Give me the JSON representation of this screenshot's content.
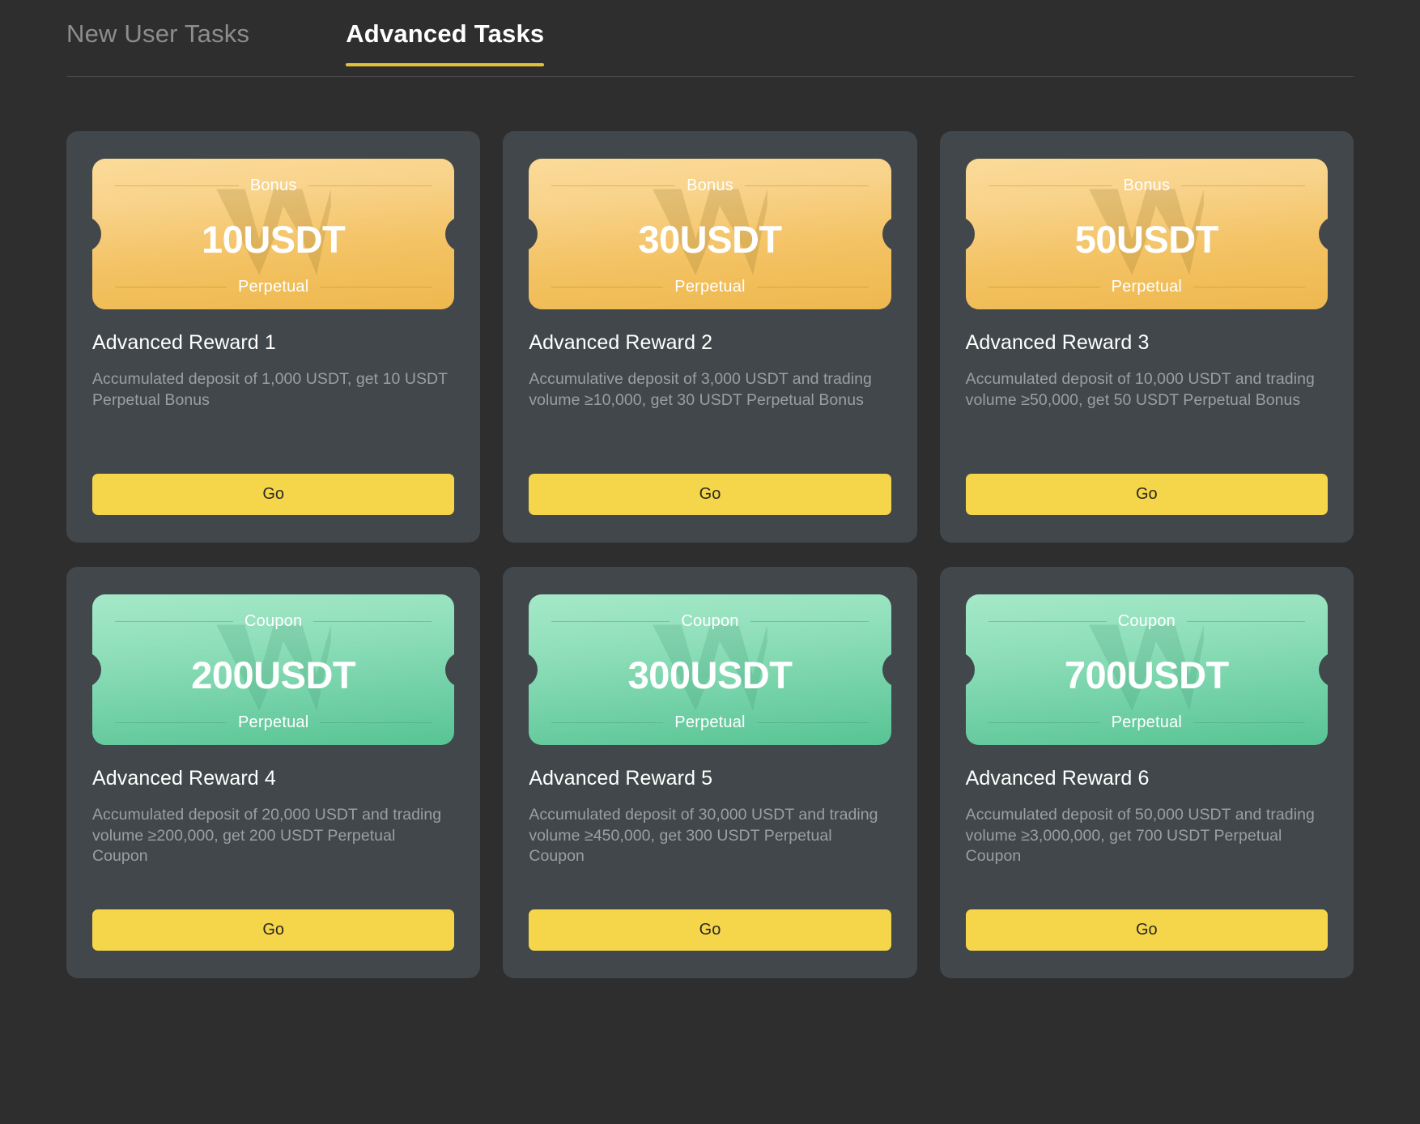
{
  "tabs": [
    {
      "label": "New User Tasks",
      "active": false
    },
    {
      "label": "Advanced Tasks",
      "active": true
    }
  ],
  "colors": {
    "page_background": "#2e2e2e",
    "card_background": "#41474a",
    "tab_active_underline": "#e3c03c",
    "go_button": "#f5d54a",
    "bonus_ticket": "#f3c263",
    "coupon_ticket": "#6fcfa4",
    "title_text": "#ffffff",
    "desc_text": "#9aa0a0"
  },
  "cards": [
    {
      "ticket_type": "Bonus",
      "ticket_style": "bonus",
      "amount": "10USDT",
      "ticket_footer": "Perpetual",
      "title": "Advanced Reward 1",
      "description": "Accumulated deposit of 1,000 USDT, get 10 USDT Perpetual Bonus",
      "button_label": "Go",
      "watermark": "w-logo-icon"
    },
    {
      "ticket_type": "Bonus",
      "ticket_style": "bonus",
      "amount": "30USDT",
      "ticket_footer": "Perpetual",
      "title": "Advanced Reward 2",
      "description": "Accumulative deposit of 3,000 USDT and trading volume ≥10,000, get 30 USDT Perpetual Bonus",
      "button_label": "Go",
      "watermark": "w-logo-icon"
    },
    {
      "ticket_type": "Bonus",
      "ticket_style": "bonus",
      "amount": "50USDT",
      "ticket_footer": "Perpetual",
      "title": "Advanced Reward 3",
      "description": "Accumulated deposit of 10,000 USDT and trading volume ≥50,000, get 50 USDT Perpetual Bonus",
      "button_label": "Go",
      "watermark": "w-logo-icon"
    },
    {
      "ticket_type": "Coupon",
      "ticket_style": "coupon",
      "amount": "200USDT",
      "ticket_footer": "Perpetual",
      "title": "Advanced Reward 4",
      "description": "Accumulated deposit of 20,000 USDT and trading volume ≥200,000, get 200 USDT Perpetual Coupon",
      "button_label": "Go",
      "watermark": "w-logo-icon"
    },
    {
      "ticket_type": "Coupon",
      "ticket_style": "coupon",
      "amount": "300USDT",
      "ticket_footer": "Perpetual",
      "title": "Advanced Reward 5",
      "description": "Accumulated deposit of 30,000 USDT and trading volume ≥450,000, get 300 USDT Perpetual Coupon",
      "button_label": "Go",
      "watermark": "w-logo-icon"
    },
    {
      "ticket_type": "Coupon",
      "ticket_style": "coupon",
      "amount": "700USDT",
      "ticket_footer": "Perpetual",
      "title": "Advanced Reward 6",
      "description": "Accumulated deposit of 50,000 USDT and trading volume ≥3,000,000, get 700 USDT Perpetual Coupon",
      "button_label": "Go",
      "watermark": "w-logo-icon"
    }
  ]
}
